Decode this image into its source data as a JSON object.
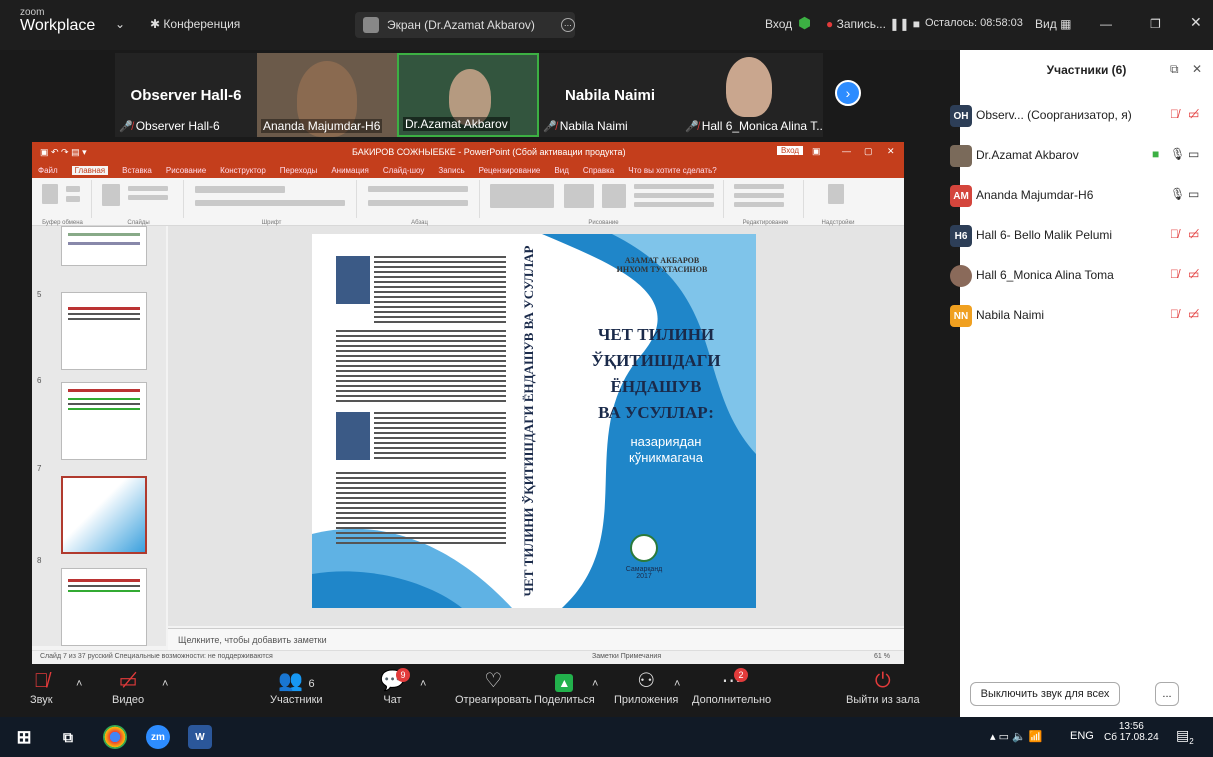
{
  "window": {
    "logo_small": "zoom",
    "logo_big": "Workplace",
    "conference_label": "Конференция",
    "screen_share_label": "Экран (Dr.Azamat Akbarov)",
    "login_label": "Вход",
    "record_label": "Запись...",
    "remaining_label": "Осталось: 08:58:03",
    "view_label": "Вид"
  },
  "video_strip": {
    "tiles": [
      {
        "big_name": "Observer Hall-6",
        "name": "Observer  Hall-6"
      },
      {
        "name": "Ananda Majumdar-H6"
      },
      {
        "name": "Dr.Azamat Akbarov"
      },
      {
        "big_name": "Nabila Naimi",
        "name": "Nabila Naimi"
      },
      {
        "name": "Hall 6_Monica Alina T..."
      }
    ]
  },
  "ppt": {
    "title": "БАКИРОВ СОЖНЫЕБКЕ  - PowerPoint (Сбой активации продукта)",
    "tabs": [
      "Файл",
      "Главная",
      "Вставка",
      "Рисование",
      "Конструктор",
      "Переходы",
      "Анимация",
      "Слайд-шоу",
      "Запись",
      "Рецензирование",
      "Вид",
      "Справка",
      "Что вы хотите сделать?"
    ],
    "ribbon_groups": [
      "Буфер обмена",
      "Слайды",
      "Шрифт",
      "Абзац",
      "Рисование",
      "Редактирование",
      "Надстройки"
    ],
    "thumb_numbers": [
      "5",
      "6",
      "7",
      "8"
    ],
    "notes_placeholder": "Щелкните, чтобы добавить заметки",
    "status_left": "Слайд 7 из 37    русский    Специальные возможности: не поддерживаются",
    "status_right": "Заметки    Примечания",
    "zoom": "61 %"
  },
  "cover": {
    "authors_line1": "АЗАМАТ АКБАРОВ",
    "authors_line2": "ИНХОМ ТУХТАСИНОВ",
    "title_lines": [
      "ЧЕТ ТИЛИНИ",
      "ЎҚИТИШДАГИ",
      "ЁНДАШУВ",
      "ВА УСУЛЛАР:"
    ],
    "subtitle_lines": [
      "назариядан",
      "кўникмагача"
    ],
    "spine_text": "ЧЕТ ТИЛИНИ ЎҚИТИШДАГИ ЁНДАШУВ ВА УСУЛЛАР",
    "city": "Самарқанд",
    "year": "2017"
  },
  "participants": {
    "header": "Участники (6)",
    "list": [
      {
        "initials": "OH",
        "name": "Observ...  (Соорганизатор, я)",
        "color": "#2d3e57"
      },
      {
        "initials": "",
        "name": "Dr.Azamat Akbarov",
        "color": "#7a6a5a"
      },
      {
        "initials": "AM",
        "name": "Ananda Majumdar-H6",
        "color": "#d4453c"
      },
      {
        "initials": "H6",
        "name": "Hall 6- Bello Malik Pelumi",
        "color": "#2d3e57"
      },
      {
        "initials": "",
        "name": "Hall 6_Monica Alina Toma",
        "color": "#8a6a5a"
      },
      {
        "initials": "NN",
        "name": "Nabila Naimi",
        "color": "#f0a020"
      }
    ],
    "mute_all_label": "Выключить звук для всех",
    "more_label": "..."
  },
  "toolbar": {
    "audio_label": "Звук",
    "video_label": "Видео",
    "participants_label": "Участники",
    "participants_count": "6",
    "chat_label": "Чат",
    "chat_badge": "9",
    "react_label": "Отреагировать",
    "share_label": "Поделиться",
    "apps_label": "Приложения",
    "more_label": "Дополнительно",
    "more_badge": "2",
    "leave_label": "Выйти из зала"
  },
  "taskbar": {
    "lang": "ENG",
    "time": "13:56",
    "date": "Сб 17.08.24",
    "notif_count": "2"
  }
}
